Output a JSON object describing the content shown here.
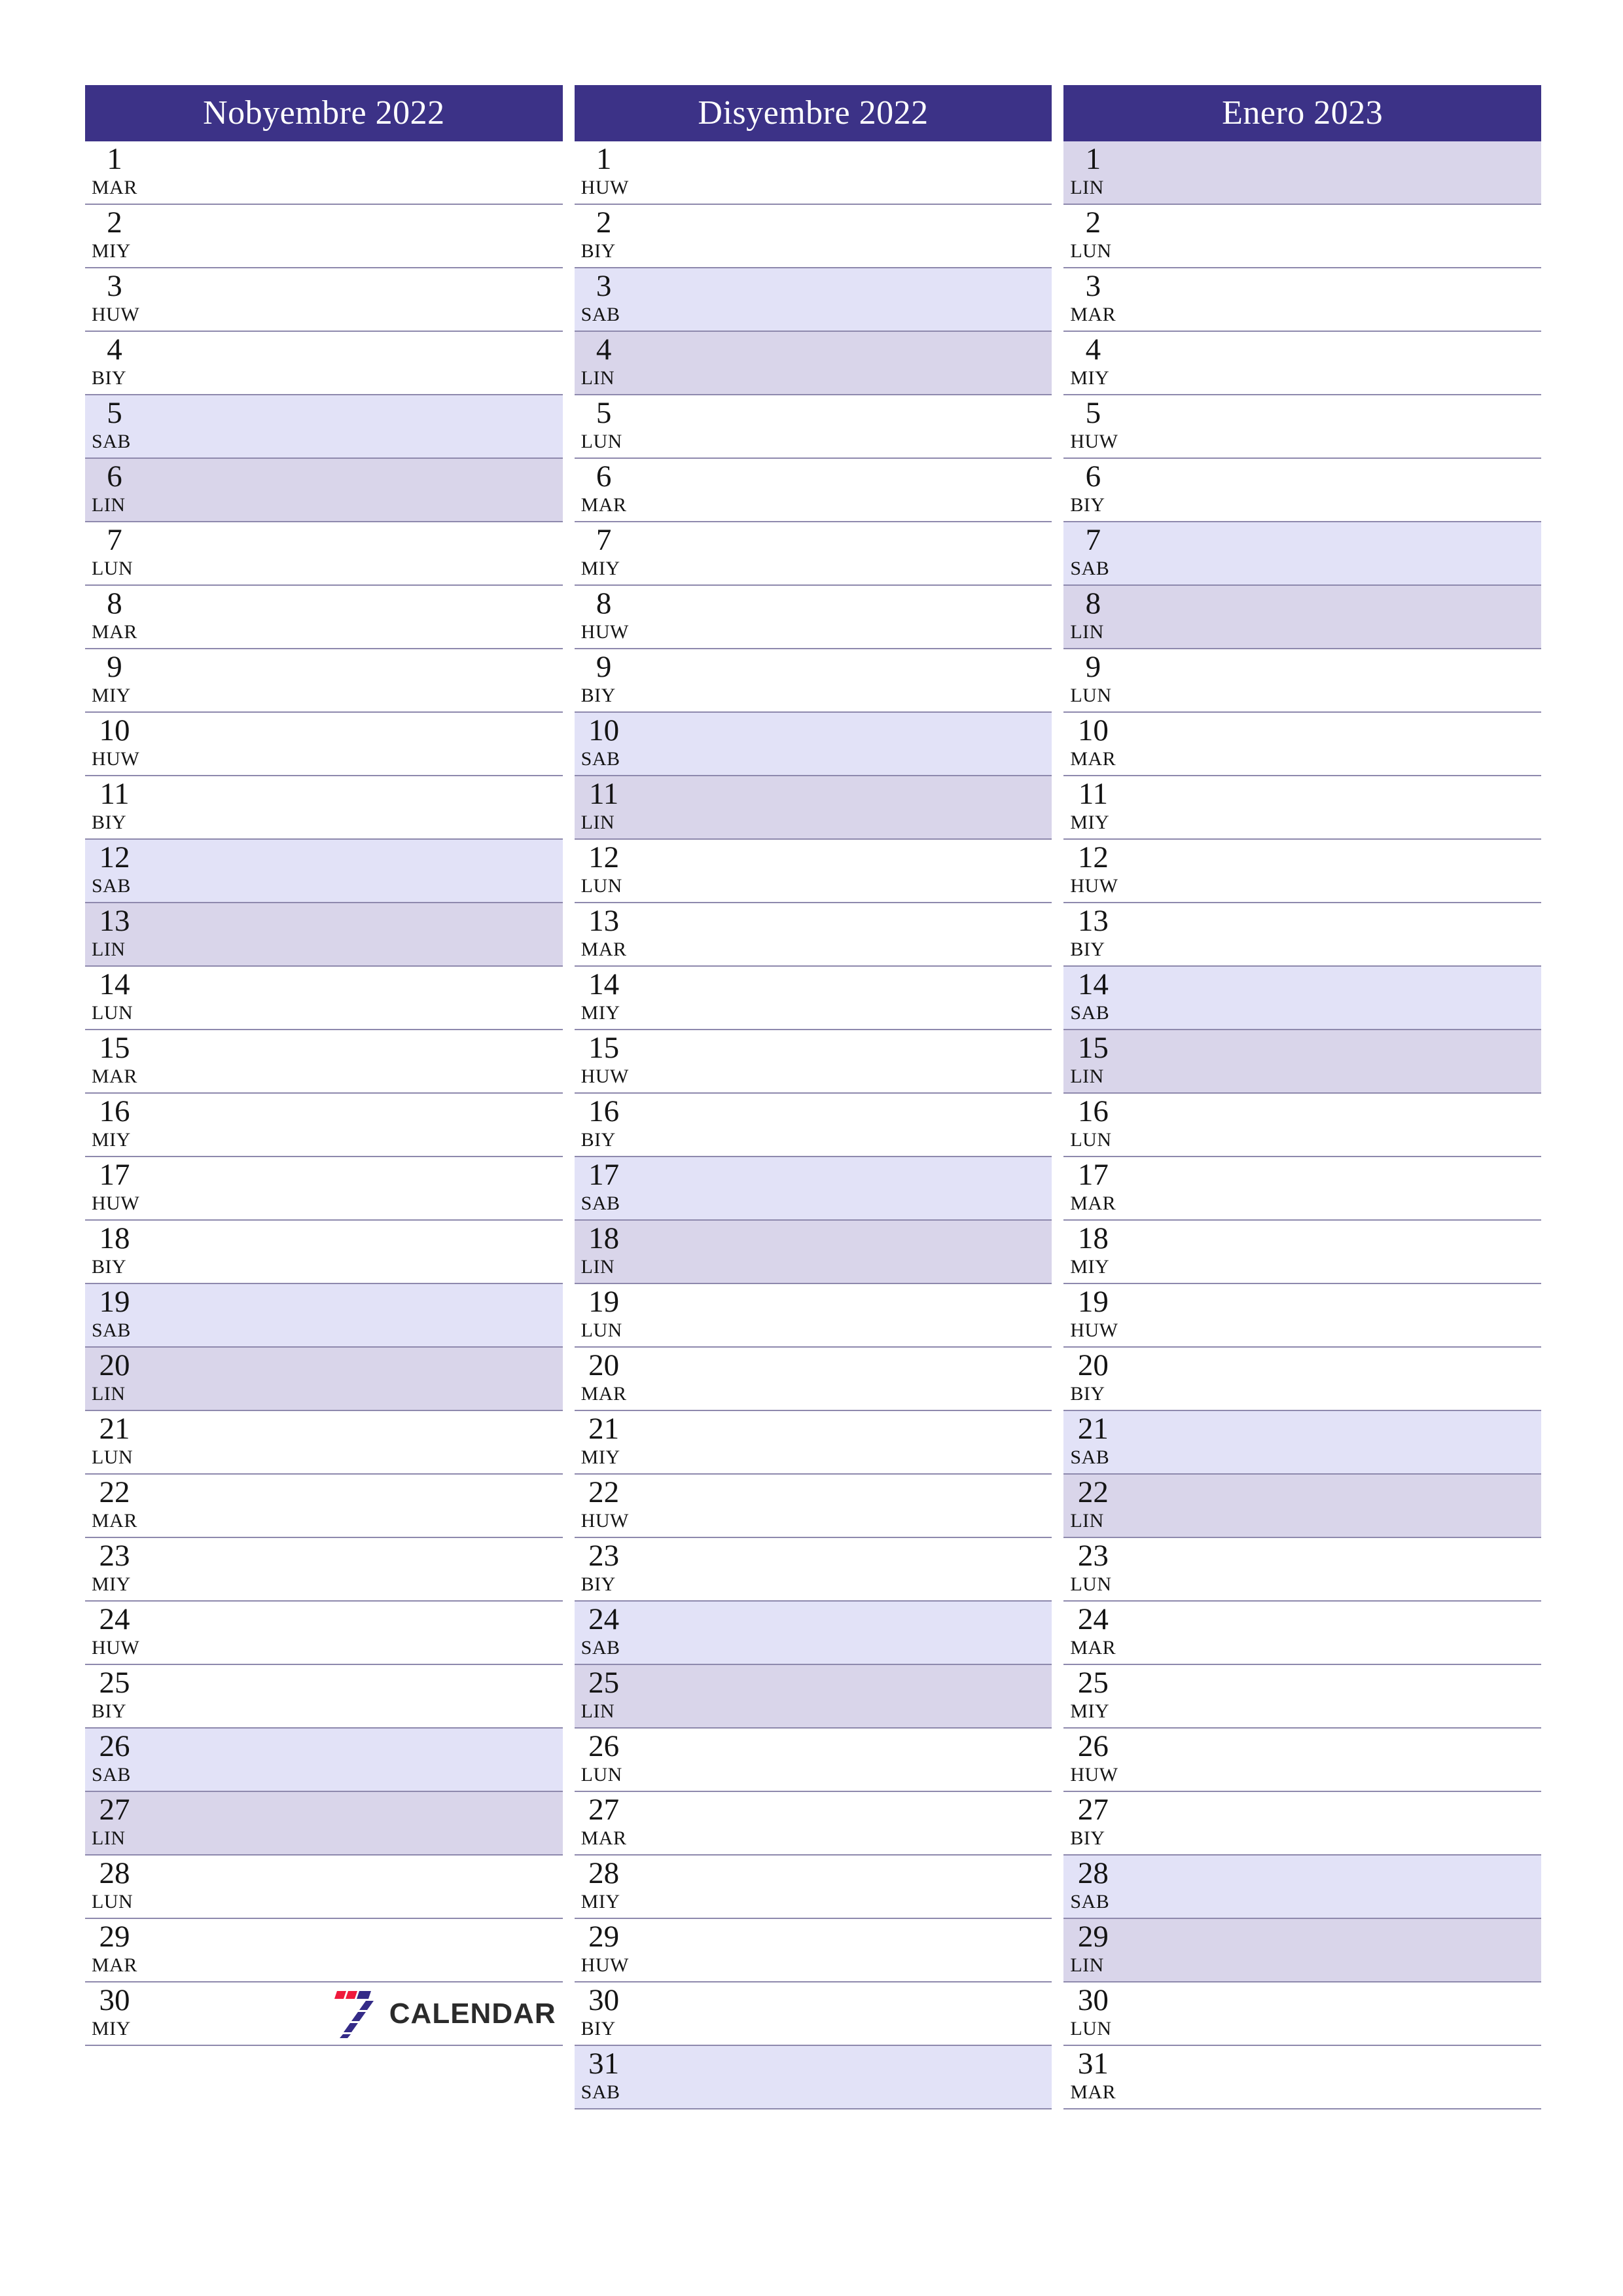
{
  "document": {
    "type": "monthly-planner-calendar",
    "orientation": "portrait",
    "language_hint": "Filipino / Tagalog day abbreviations",
    "page_size": "A4"
  },
  "theme": {
    "header_bg": "#3c3287",
    "header_text": "#ffffff",
    "saturday_bg": "#e2e2f7",
    "sunday_bg": "#d9d5ea",
    "row_border": "#8e89ad",
    "text": "#141414",
    "logo_red": "#ef1a3c",
    "logo_navy": "#342b87",
    "logo_word": "#2b2b2b"
  },
  "weekday_abbreviations": {
    "LUN": "Lunes",
    "MAR": "Martes",
    "MIY": "Miyerkules",
    "HUW": "Huwebes",
    "BIY": "Biyernes",
    "SAB": "Sabado",
    "LIN": "Linggo"
  },
  "brand": {
    "mark_name": "seven-logo",
    "word": "CALENDAR"
  },
  "months": [
    {
      "title": "Nobyembre 2022",
      "show_logo": true,
      "days": [
        {
          "num": "1",
          "abbr": "MAR",
          "type": "weekday"
        },
        {
          "num": "2",
          "abbr": "MIY",
          "type": "weekday"
        },
        {
          "num": "3",
          "abbr": "HUW",
          "type": "weekday"
        },
        {
          "num": "4",
          "abbr": "BIY",
          "type": "weekday"
        },
        {
          "num": "5",
          "abbr": "SAB",
          "type": "saturday"
        },
        {
          "num": "6",
          "abbr": "LIN",
          "type": "sunday"
        },
        {
          "num": "7",
          "abbr": "LUN",
          "type": "weekday"
        },
        {
          "num": "8",
          "abbr": "MAR",
          "type": "weekday"
        },
        {
          "num": "9",
          "abbr": "MIY",
          "type": "weekday"
        },
        {
          "num": "10",
          "abbr": "HUW",
          "type": "weekday"
        },
        {
          "num": "11",
          "abbr": "BIY",
          "type": "weekday"
        },
        {
          "num": "12",
          "abbr": "SAB",
          "type": "saturday"
        },
        {
          "num": "13",
          "abbr": "LIN",
          "type": "sunday"
        },
        {
          "num": "14",
          "abbr": "LUN",
          "type": "weekday"
        },
        {
          "num": "15",
          "abbr": "MAR",
          "type": "weekday"
        },
        {
          "num": "16",
          "abbr": "MIY",
          "type": "weekday"
        },
        {
          "num": "17",
          "abbr": "HUW",
          "type": "weekday"
        },
        {
          "num": "18",
          "abbr": "BIY",
          "type": "weekday"
        },
        {
          "num": "19",
          "abbr": "SAB",
          "type": "saturday"
        },
        {
          "num": "20",
          "abbr": "LIN",
          "type": "sunday"
        },
        {
          "num": "21",
          "abbr": "LUN",
          "type": "weekday"
        },
        {
          "num": "22",
          "abbr": "MAR",
          "type": "weekday"
        },
        {
          "num": "23",
          "abbr": "MIY",
          "type": "weekday"
        },
        {
          "num": "24",
          "abbr": "HUW",
          "type": "weekday"
        },
        {
          "num": "25",
          "abbr": "BIY",
          "type": "weekday"
        },
        {
          "num": "26",
          "abbr": "SAB",
          "type": "saturday"
        },
        {
          "num": "27",
          "abbr": "LIN",
          "type": "sunday"
        },
        {
          "num": "28",
          "abbr": "LUN",
          "type": "weekday"
        },
        {
          "num": "29",
          "abbr": "MAR",
          "type": "weekday"
        },
        {
          "num": "30",
          "abbr": "MIY",
          "type": "weekday"
        }
      ]
    },
    {
      "title": "Disyembre 2022",
      "show_logo": false,
      "days": [
        {
          "num": "1",
          "abbr": "HUW",
          "type": "weekday"
        },
        {
          "num": "2",
          "abbr": "BIY",
          "type": "weekday"
        },
        {
          "num": "3",
          "abbr": "SAB",
          "type": "saturday"
        },
        {
          "num": "4",
          "abbr": "LIN",
          "type": "sunday"
        },
        {
          "num": "5",
          "abbr": "LUN",
          "type": "weekday"
        },
        {
          "num": "6",
          "abbr": "MAR",
          "type": "weekday"
        },
        {
          "num": "7",
          "abbr": "MIY",
          "type": "weekday"
        },
        {
          "num": "8",
          "abbr": "HUW",
          "type": "weekday"
        },
        {
          "num": "9",
          "abbr": "BIY",
          "type": "weekday"
        },
        {
          "num": "10",
          "abbr": "SAB",
          "type": "saturday"
        },
        {
          "num": "11",
          "abbr": "LIN",
          "type": "sunday"
        },
        {
          "num": "12",
          "abbr": "LUN",
          "type": "weekday"
        },
        {
          "num": "13",
          "abbr": "MAR",
          "type": "weekday"
        },
        {
          "num": "14",
          "abbr": "MIY",
          "type": "weekday"
        },
        {
          "num": "15",
          "abbr": "HUW",
          "type": "weekday"
        },
        {
          "num": "16",
          "abbr": "BIY",
          "type": "weekday"
        },
        {
          "num": "17",
          "abbr": "SAB",
          "type": "saturday"
        },
        {
          "num": "18",
          "abbr": "LIN",
          "type": "sunday"
        },
        {
          "num": "19",
          "abbr": "LUN",
          "type": "weekday"
        },
        {
          "num": "20",
          "abbr": "MAR",
          "type": "weekday"
        },
        {
          "num": "21",
          "abbr": "MIY",
          "type": "weekday"
        },
        {
          "num": "22",
          "abbr": "HUW",
          "type": "weekday"
        },
        {
          "num": "23",
          "abbr": "BIY",
          "type": "weekday"
        },
        {
          "num": "24",
          "abbr": "SAB",
          "type": "saturday"
        },
        {
          "num": "25",
          "abbr": "LIN",
          "type": "sunday"
        },
        {
          "num": "26",
          "abbr": "LUN",
          "type": "weekday"
        },
        {
          "num": "27",
          "abbr": "MAR",
          "type": "weekday"
        },
        {
          "num": "28",
          "abbr": "MIY",
          "type": "weekday"
        },
        {
          "num": "29",
          "abbr": "HUW",
          "type": "weekday"
        },
        {
          "num": "30",
          "abbr": "BIY",
          "type": "weekday"
        },
        {
          "num": "31",
          "abbr": "SAB",
          "type": "saturday"
        }
      ]
    },
    {
      "title": "Enero 2023",
      "show_logo": false,
      "days": [
        {
          "num": "1",
          "abbr": "LIN",
          "type": "sunday"
        },
        {
          "num": "2",
          "abbr": "LUN",
          "type": "weekday"
        },
        {
          "num": "3",
          "abbr": "MAR",
          "type": "weekday"
        },
        {
          "num": "4",
          "abbr": "MIY",
          "type": "weekday"
        },
        {
          "num": "5",
          "abbr": "HUW",
          "type": "weekday"
        },
        {
          "num": "6",
          "abbr": "BIY",
          "type": "weekday"
        },
        {
          "num": "7",
          "abbr": "SAB",
          "type": "saturday"
        },
        {
          "num": "8",
          "abbr": "LIN",
          "type": "sunday"
        },
        {
          "num": "9",
          "abbr": "LUN",
          "type": "weekday"
        },
        {
          "num": "10",
          "abbr": "MAR",
          "type": "weekday"
        },
        {
          "num": "11",
          "abbr": "MIY",
          "type": "weekday"
        },
        {
          "num": "12",
          "abbr": "HUW",
          "type": "weekday"
        },
        {
          "num": "13",
          "abbr": "BIY",
          "type": "weekday"
        },
        {
          "num": "14",
          "abbr": "SAB",
          "type": "saturday"
        },
        {
          "num": "15",
          "abbr": "LIN",
          "type": "sunday"
        },
        {
          "num": "16",
          "abbr": "LUN",
          "type": "weekday"
        },
        {
          "num": "17",
          "abbr": "MAR",
          "type": "weekday"
        },
        {
          "num": "18",
          "abbr": "MIY",
          "type": "weekday"
        },
        {
          "num": "19",
          "abbr": "HUW",
          "type": "weekday"
        },
        {
          "num": "20",
          "abbr": "BIY",
          "type": "weekday"
        },
        {
          "num": "21",
          "abbr": "SAB",
          "type": "saturday"
        },
        {
          "num": "22",
          "abbr": "LIN",
          "type": "sunday"
        },
        {
          "num": "23",
          "abbr": "LUN",
          "type": "weekday"
        },
        {
          "num": "24",
          "abbr": "MAR",
          "type": "weekday"
        },
        {
          "num": "25",
          "abbr": "MIY",
          "type": "weekday"
        },
        {
          "num": "26",
          "abbr": "HUW",
          "type": "weekday"
        },
        {
          "num": "27",
          "abbr": "BIY",
          "type": "weekday"
        },
        {
          "num": "28",
          "abbr": "SAB",
          "type": "saturday"
        },
        {
          "num": "29",
          "abbr": "LIN",
          "type": "sunday"
        },
        {
          "num": "30",
          "abbr": "LUN",
          "type": "weekday"
        },
        {
          "num": "31",
          "abbr": "MAR",
          "type": "weekday"
        }
      ]
    }
  ]
}
